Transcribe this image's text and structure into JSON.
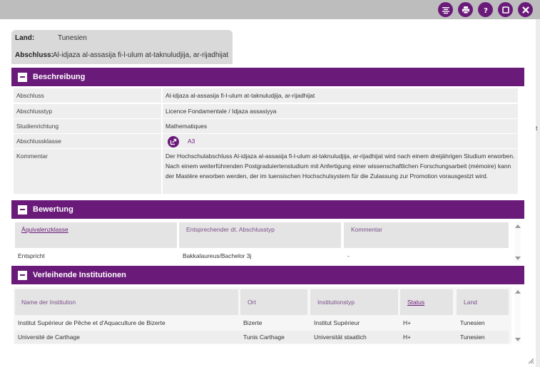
{
  "info": {
    "land_label": "Land:",
    "land_value": "Tunesien",
    "abschluss_label": "Abschluss:",
    "abschluss_value": "Al-idjaza al-assasija fi-l-ulum at-taknuludjija, ar-rijadhijat"
  },
  "beschreibung": {
    "title": "Beschreibung",
    "rows": [
      {
        "key": "Abschluss",
        "value": "Al-idjaza al-assasija fi-l-ulum at-taknuludjija, ar-rijadhijat"
      },
      {
        "key": "Abschlusstyp",
        "value": "Licence Fondamentale / Idjaza assasiyya"
      },
      {
        "key": "Studienrichtung",
        "value": "Mathematiques"
      },
      {
        "key": "Abschlussklasse",
        "value": "A3"
      },
      {
        "key": "Kommentar",
        "value": "Der Hochschulabschluss Al-idjaza al-assasija fi-l-ulum at-taknuludjija, ar-rijadhijat wird nach einem dreijährigen Studium erworben. Nach einem weiterführenden Postgraduiertenstudium mit Anfertigung einer wissenschaftlichen Forschungsarbeit (mémoire) kann der Mastère erworben werden, der im tuensischen Hochschulsystem für die Zulassung zur Promotion vorausgestzt wird."
      }
    ]
  },
  "bewertung": {
    "title": "Bewertung",
    "columns": [
      "Äquivalenzklasse",
      "Entsprechender dt. Abschlusstyp",
      "Kommentar"
    ],
    "rows": [
      [
        "Entspricht",
        "Bakkalaureus/Bachelor 3j",
        "-"
      ]
    ]
  },
  "institutionen": {
    "title": "Verleihende Institutionen",
    "columns": [
      "Name der Institution",
      "Ort",
      "Institutionstyp",
      "Status",
      "Land"
    ],
    "rows": [
      [
        "Institut Supérieur de Pêche et d'Aquaculture de Bizerte",
        "Bizerte",
        "Institut Supérieur",
        "H+",
        "Tunesien"
      ],
      [
        "Université de Carthage",
        "Tunis Carthage",
        "Universität staatlich",
        "H+",
        "Tunesien"
      ]
    ]
  },
  "toolbar": {
    "icons": [
      "list-icon",
      "print-icon",
      "help-icon",
      "maximize-icon",
      "close-icon"
    ]
  },
  "colors": {
    "accent": "#6a1b79",
    "topbar": "#bdbdbd",
    "row_bg": "#eeeeee"
  }
}
